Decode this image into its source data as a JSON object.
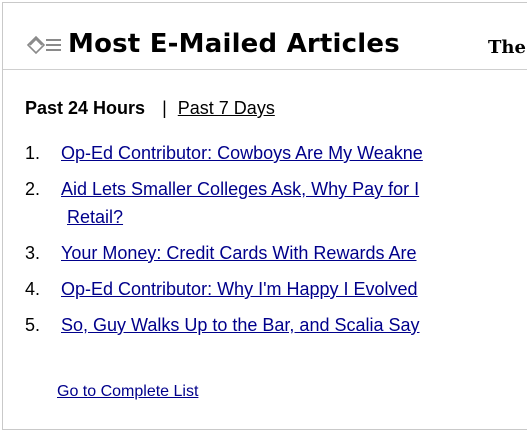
{
  "header": {
    "icon": "envelope-icon",
    "title": "Most E-Mailed Articles",
    "brand": "The"
  },
  "tabs": {
    "active": "Past 24 Hours",
    "separator": "|",
    "other": "Past 7 Days"
  },
  "articles": [
    {
      "number": "1.",
      "title": "Op-Ed Contributor: Cowboys Are My Weakne"
    },
    {
      "number": "2.",
      "title": "Aid Lets Smaller Colleges Ask, Why Pay for I",
      "title_cont": "Retail?"
    },
    {
      "number": "3.",
      "title": "Your Money: Credit Cards With Rewards Are"
    },
    {
      "number": "4.",
      "title": "Op-Ed Contributor: Why I'm Happy I Evolved"
    },
    {
      "number": "5.",
      "title": "So, Guy Walks Up to the Bar, and Scalia Say"
    }
  ],
  "footer": {
    "complete_list": "Go to Complete List"
  },
  "colors": {
    "link": "#00008b",
    "border": "#c9c9c9"
  }
}
